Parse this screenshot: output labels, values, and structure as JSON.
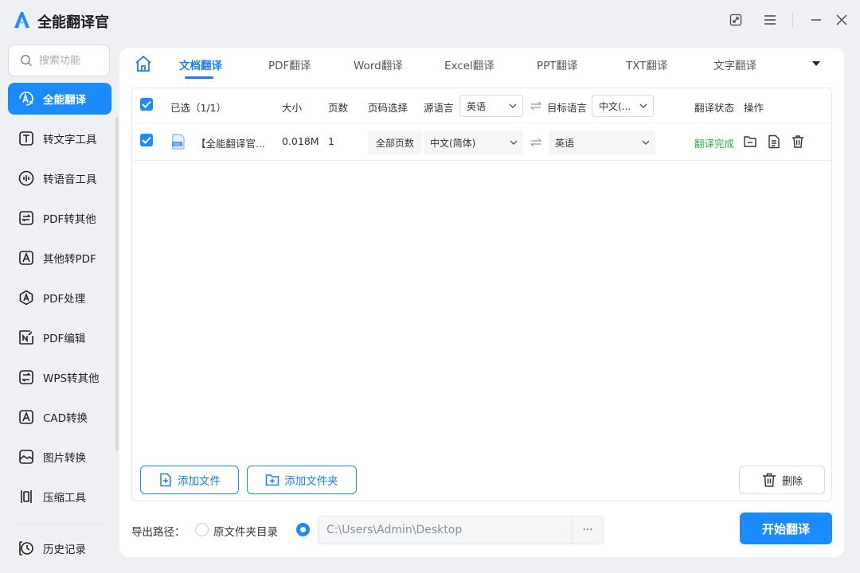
{
  "app": {
    "title": "全能翻译官"
  },
  "window_controls": [
    {
      "name": "shrink-icon"
    },
    {
      "name": "menu-icon"
    },
    {
      "name": "minimize-icon"
    },
    {
      "name": "close-icon"
    }
  ],
  "sidebar": {
    "search_placeholder": "搜索功能",
    "items": [
      {
        "label": "全能翻译",
        "icon": "translate-icon",
        "active": true
      },
      {
        "label": "转文字工具",
        "icon": "text-icon"
      },
      {
        "label": "转语音工具",
        "icon": "voice-icon"
      },
      {
        "label": "PDF转其他",
        "icon": "pdf-convert-icon"
      },
      {
        "label": "其他转PDF",
        "icon": "to-pdf-icon"
      },
      {
        "label": "PDF处理",
        "icon": "pdf-process-icon"
      },
      {
        "label": "PDF编辑",
        "icon": "pdf-edit-icon"
      },
      {
        "label": "WPS转其他",
        "icon": "wps-icon"
      },
      {
        "label": "CAD转换",
        "icon": "cad-icon"
      },
      {
        "label": "图片转换",
        "icon": "image-icon"
      },
      {
        "label": "压缩工具",
        "icon": "compress-icon"
      }
    ],
    "history_label": "历史记录"
  },
  "tabs": [
    {
      "label": "文档翻译",
      "active": true
    },
    {
      "label": "PDF翻译"
    },
    {
      "label": "Word翻译"
    },
    {
      "label": "Excel翻译"
    },
    {
      "label": "PPT翻译"
    },
    {
      "label": "TXT翻译"
    },
    {
      "label": "文字翻译"
    }
  ],
  "table": {
    "header": {
      "selected": "已选（1/1）",
      "size": "大小",
      "pages": "页数",
      "page_select": "页码选择",
      "source_lang_label": "源语言",
      "source_lang_value": "英语",
      "target_lang_label": "目标语言",
      "target_lang_value": "中文(...",
      "status": "翻译状态",
      "actions": "操作"
    },
    "rows": [
      {
        "file_name": "【全能翻译官...",
        "size": "0.018M",
        "pages": "1",
        "page_select": "全部页数",
        "source_lang": "中文(简体)",
        "target_lang": "英语",
        "status": "翻译完成"
      }
    ]
  },
  "buttons": {
    "add_file": "添加文件",
    "add_folder": "添加文件夹",
    "delete": "删除",
    "start": "开始翻译"
  },
  "export": {
    "label": "导出路径：",
    "option_original": "原文件夹目录",
    "path": "C:\\Users\\Admin\\Desktop",
    "more": "···"
  },
  "colors": {
    "accent": "#1a8cff",
    "success": "#2bb24c"
  }
}
